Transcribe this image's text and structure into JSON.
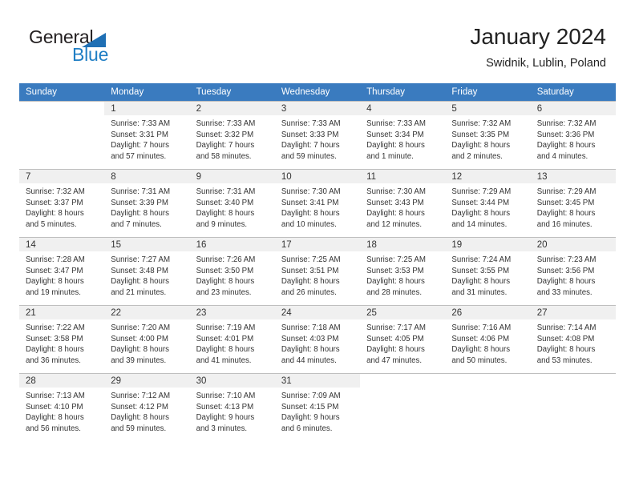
{
  "logo": {
    "word_top": "General",
    "word_bottom": "Blue",
    "triangle_color": "#1f6fb4",
    "blue_color": "#1f7ec4"
  },
  "header": {
    "title": "January 2024",
    "subtitle": "Swidnik, Lublin, Poland"
  },
  "theme": {
    "header_row_bg": "#3a7bbf",
    "header_row_text": "#ffffff",
    "daynum_band_bg": "#f0f0f0",
    "grid_line": "#bfbfbf"
  },
  "weekday_headers": [
    "Sunday",
    "Monday",
    "Tuesday",
    "Wednesday",
    "Thursday",
    "Friday",
    "Saturday"
  ],
  "labels": {
    "sunrise_prefix": "Sunrise:",
    "sunset_prefix": "Sunset:",
    "daylight_prefix": "Daylight:"
  },
  "weeks": [
    [
      {
        "day": "",
        "empty": true,
        "sunrise": "",
        "sunset": "",
        "daylight_line1": "",
        "daylight_line2": ""
      },
      {
        "day": "1",
        "sunrise": "Sunrise: 7:33 AM",
        "sunset": "Sunset: 3:31 PM",
        "daylight_line1": "Daylight: 7 hours",
        "daylight_line2": "and 57 minutes."
      },
      {
        "day": "2",
        "sunrise": "Sunrise: 7:33 AM",
        "sunset": "Sunset: 3:32 PM",
        "daylight_line1": "Daylight: 7 hours",
        "daylight_line2": "and 58 minutes."
      },
      {
        "day": "3",
        "sunrise": "Sunrise: 7:33 AM",
        "sunset": "Sunset: 3:33 PM",
        "daylight_line1": "Daylight: 7 hours",
        "daylight_line2": "and 59 minutes."
      },
      {
        "day": "4",
        "sunrise": "Sunrise: 7:33 AM",
        "sunset": "Sunset: 3:34 PM",
        "daylight_line1": "Daylight: 8 hours",
        "daylight_line2": "and 1 minute."
      },
      {
        "day": "5",
        "sunrise": "Sunrise: 7:32 AM",
        "sunset": "Sunset: 3:35 PM",
        "daylight_line1": "Daylight: 8 hours",
        "daylight_line2": "and 2 minutes."
      },
      {
        "day": "6",
        "sunrise": "Sunrise: 7:32 AM",
        "sunset": "Sunset: 3:36 PM",
        "daylight_line1": "Daylight: 8 hours",
        "daylight_line2": "and 4 minutes."
      }
    ],
    [
      {
        "day": "7",
        "sunrise": "Sunrise: 7:32 AM",
        "sunset": "Sunset: 3:37 PM",
        "daylight_line1": "Daylight: 8 hours",
        "daylight_line2": "and 5 minutes."
      },
      {
        "day": "8",
        "sunrise": "Sunrise: 7:31 AM",
        "sunset": "Sunset: 3:39 PM",
        "daylight_line1": "Daylight: 8 hours",
        "daylight_line2": "and 7 minutes."
      },
      {
        "day": "9",
        "sunrise": "Sunrise: 7:31 AM",
        "sunset": "Sunset: 3:40 PM",
        "daylight_line1": "Daylight: 8 hours",
        "daylight_line2": "and 9 minutes."
      },
      {
        "day": "10",
        "sunrise": "Sunrise: 7:30 AM",
        "sunset": "Sunset: 3:41 PM",
        "daylight_line1": "Daylight: 8 hours",
        "daylight_line2": "and 10 minutes."
      },
      {
        "day": "11",
        "sunrise": "Sunrise: 7:30 AM",
        "sunset": "Sunset: 3:43 PM",
        "daylight_line1": "Daylight: 8 hours",
        "daylight_line2": "and 12 minutes."
      },
      {
        "day": "12",
        "sunrise": "Sunrise: 7:29 AM",
        "sunset": "Sunset: 3:44 PM",
        "daylight_line1": "Daylight: 8 hours",
        "daylight_line2": "and 14 minutes."
      },
      {
        "day": "13",
        "sunrise": "Sunrise: 7:29 AM",
        "sunset": "Sunset: 3:45 PM",
        "daylight_line1": "Daylight: 8 hours",
        "daylight_line2": "and 16 minutes."
      }
    ],
    [
      {
        "day": "14",
        "sunrise": "Sunrise: 7:28 AM",
        "sunset": "Sunset: 3:47 PM",
        "daylight_line1": "Daylight: 8 hours",
        "daylight_line2": "and 19 minutes."
      },
      {
        "day": "15",
        "sunrise": "Sunrise: 7:27 AM",
        "sunset": "Sunset: 3:48 PM",
        "daylight_line1": "Daylight: 8 hours",
        "daylight_line2": "and 21 minutes."
      },
      {
        "day": "16",
        "sunrise": "Sunrise: 7:26 AM",
        "sunset": "Sunset: 3:50 PM",
        "daylight_line1": "Daylight: 8 hours",
        "daylight_line2": "and 23 minutes."
      },
      {
        "day": "17",
        "sunrise": "Sunrise: 7:25 AM",
        "sunset": "Sunset: 3:51 PM",
        "daylight_line1": "Daylight: 8 hours",
        "daylight_line2": "and 26 minutes."
      },
      {
        "day": "18",
        "sunrise": "Sunrise: 7:25 AM",
        "sunset": "Sunset: 3:53 PM",
        "daylight_line1": "Daylight: 8 hours",
        "daylight_line2": "and 28 minutes."
      },
      {
        "day": "19",
        "sunrise": "Sunrise: 7:24 AM",
        "sunset": "Sunset: 3:55 PM",
        "daylight_line1": "Daylight: 8 hours",
        "daylight_line2": "and 31 minutes."
      },
      {
        "day": "20",
        "sunrise": "Sunrise: 7:23 AM",
        "sunset": "Sunset: 3:56 PM",
        "daylight_line1": "Daylight: 8 hours",
        "daylight_line2": "and 33 minutes."
      }
    ],
    [
      {
        "day": "21",
        "sunrise": "Sunrise: 7:22 AM",
        "sunset": "Sunset: 3:58 PM",
        "daylight_line1": "Daylight: 8 hours",
        "daylight_line2": "and 36 minutes."
      },
      {
        "day": "22",
        "sunrise": "Sunrise: 7:20 AM",
        "sunset": "Sunset: 4:00 PM",
        "daylight_line1": "Daylight: 8 hours",
        "daylight_line2": "and 39 minutes."
      },
      {
        "day": "23",
        "sunrise": "Sunrise: 7:19 AM",
        "sunset": "Sunset: 4:01 PM",
        "daylight_line1": "Daylight: 8 hours",
        "daylight_line2": "and 41 minutes."
      },
      {
        "day": "24",
        "sunrise": "Sunrise: 7:18 AM",
        "sunset": "Sunset: 4:03 PM",
        "daylight_line1": "Daylight: 8 hours",
        "daylight_line2": "and 44 minutes."
      },
      {
        "day": "25",
        "sunrise": "Sunrise: 7:17 AM",
        "sunset": "Sunset: 4:05 PM",
        "daylight_line1": "Daylight: 8 hours",
        "daylight_line2": "and 47 minutes."
      },
      {
        "day": "26",
        "sunrise": "Sunrise: 7:16 AM",
        "sunset": "Sunset: 4:06 PM",
        "daylight_line1": "Daylight: 8 hours",
        "daylight_line2": "and 50 minutes."
      },
      {
        "day": "27",
        "sunrise": "Sunrise: 7:14 AM",
        "sunset": "Sunset: 4:08 PM",
        "daylight_line1": "Daylight: 8 hours",
        "daylight_line2": "and 53 minutes."
      }
    ],
    [
      {
        "day": "28",
        "sunrise": "Sunrise: 7:13 AM",
        "sunset": "Sunset: 4:10 PM",
        "daylight_line1": "Daylight: 8 hours",
        "daylight_line2": "and 56 minutes."
      },
      {
        "day": "29",
        "sunrise": "Sunrise: 7:12 AM",
        "sunset": "Sunset: 4:12 PM",
        "daylight_line1": "Daylight: 8 hours",
        "daylight_line2": "and 59 minutes."
      },
      {
        "day": "30",
        "sunrise": "Sunrise: 7:10 AM",
        "sunset": "Sunset: 4:13 PM",
        "daylight_line1": "Daylight: 9 hours",
        "daylight_line2": "and 3 minutes."
      },
      {
        "day": "31",
        "sunrise": "Sunrise: 7:09 AM",
        "sunset": "Sunset: 4:15 PM",
        "daylight_line1": "Daylight: 9 hours",
        "daylight_line2": "and 6 minutes."
      },
      {
        "day": "",
        "empty": true,
        "sunrise": "",
        "sunset": "",
        "daylight_line1": "",
        "daylight_line2": ""
      },
      {
        "day": "",
        "empty": true,
        "sunrise": "",
        "sunset": "",
        "daylight_line1": "",
        "daylight_line2": ""
      },
      {
        "day": "",
        "empty": true,
        "sunrise": "",
        "sunset": "",
        "daylight_line1": "",
        "daylight_line2": ""
      }
    ]
  ]
}
